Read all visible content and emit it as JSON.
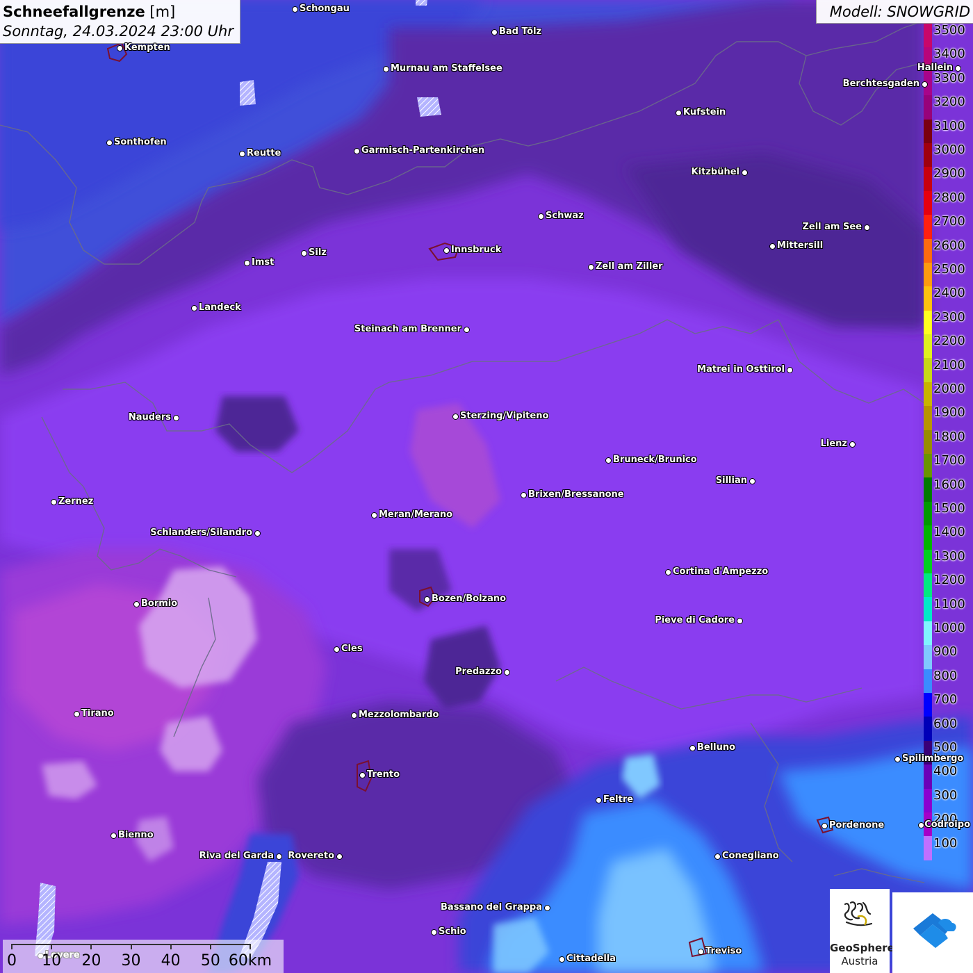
{
  "header": {
    "title_bold": "Schneefallgrenze",
    "title_unit": "[m]",
    "datetime": "Sonntag, 24.03.2024 23:00 Uhr",
    "model": "Modell: SNOWGRID"
  },
  "legend": {
    "unit": "m",
    "entries": [
      {
        "label": "3500",
        "color": "#c8076a"
      },
      {
        "label": "3400",
        "color": "#b8057a"
      },
      {
        "label": "3300",
        "color": "#a8048a"
      },
      {
        "label": "3200",
        "color": "#98027a"
      },
      {
        "label": "3100",
        "color": "#7a0010"
      },
      {
        "label": "3000",
        "color": "#a00010"
      },
      {
        "label": "2900",
        "color": "#c80010"
      },
      {
        "label": "2800",
        "color": "#e60010"
      },
      {
        "label": "2700",
        "color": "#ff2010"
      },
      {
        "label": "2600",
        "color": "#ff6a10"
      },
      {
        "label": "2500",
        "color": "#ff9a10"
      },
      {
        "label": "2400",
        "color": "#ffc010"
      },
      {
        "label": "2300",
        "color": "#ffff20"
      },
      {
        "label": "2200",
        "color": "#e0f020"
      },
      {
        "label": "2100",
        "color": "#c8d818"
      },
      {
        "label": "2000",
        "color": "#c8b400"
      },
      {
        "label": "1900",
        "color": "#b89400"
      },
      {
        "label": "1800",
        "color": "#988c00"
      },
      {
        "label": "1700",
        "color": "#6a9400"
      },
      {
        "label": "1600",
        "color": "#007a00"
      },
      {
        "label": "1500",
        "color": "#009a00"
      },
      {
        "label": "1400",
        "color": "#00b400"
      },
      {
        "label": "1300",
        "color": "#00d020"
      },
      {
        "label": "1200",
        "color": "#00e880"
      },
      {
        "label": "1100",
        "color": "#00e8c8"
      },
      {
        "label": "1000",
        "color": "#80f4ff"
      },
      {
        "label": "900",
        "color": "#80c8ff"
      },
      {
        "label": "800",
        "color": "#3a8cff"
      },
      {
        "label": "700",
        "color": "#0000ff"
      },
      {
        "label": "600",
        "color": "#0000b8"
      },
      {
        "label": "500",
        "color": "#3a0078"
      },
      {
        "label": "400",
        "color": "#6a00b8"
      },
      {
        "label": "300",
        "color": "#8a00d0"
      },
      {
        "label": "200",
        "color": "#a400c8"
      },
      {
        "label": "100",
        "color": "#c070ff"
      }
    ]
  },
  "cities": [
    {
      "name": "Schongau",
      "side": "right"
    },
    {
      "name": "Kempten",
      "side": "right"
    },
    {
      "name": "Bad Tölz",
      "side": "right"
    },
    {
      "name": "Murnau am Staffelsee",
      "side": "right"
    },
    {
      "name": "Berchtesgaden",
      "side": "left"
    },
    {
      "name": "Kufstein",
      "side": "right"
    },
    {
      "name": "Sonthofen",
      "side": "right"
    },
    {
      "name": "Reutte",
      "side": "right"
    },
    {
      "name": "Garmisch-Partenkirchen",
      "side": "right"
    },
    {
      "name": "Kitzbühel",
      "side": "left"
    },
    {
      "name": "Schwaz",
      "side": "right"
    },
    {
      "name": "Zell am See",
      "side": "left"
    },
    {
      "name": "Mittersill",
      "side": "right"
    },
    {
      "name": "Innsbruck",
      "side": "right"
    },
    {
      "name": "Imst",
      "side": "right"
    },
    {
      "name": "Silz",
      "side": "right"
    },
    {
      "name": "Zell am Ziller",
      "side": "right"
    },
    {
      "name": "Landeck",
      "side": "right"
    },
    {
      "name": "Steinach am Brenner",
      "side": "left"
    },
    {
      "name": "Matrei in Osttirol",
      "side": "left"
    },
    {
      "name": "Nauders",
      "side": "left"
    },
    {
      "name": "Sterzing/Vipiteno",
      "side": "right"
    },
    {
      "name": "Lienz",
      "side": "left"
    },
    {
      "name": "Bruneck/Brunico",
      "side": "right"
    },
    {
      "name": "Sillian",
      "side": "left"
    },
    {
      "name": "Zernez",
      "side": "right"
    },
    {
      "name": "Brixen/Bressanone",
      "side": "right"
    },
    {
      "name": "Meran/Merano",
      "side": "right"
    },
    {
      "name": "Schlanders/Silandro",
      "side": "left"
    },
    {
      "name": "Cortina d'Ampezzo",
      "side": "right"
    },
    {
      "name": "Bormio",
      "side": "right"
    },
    {
      "name": "Bozen/Bolzano",
      "side": "right"
    },
    {
      "name": "Pieve di Cadore",
      "side": "left"
    },
    {
      "name": "Cles",
      "side": "right"
    },
    {
      "name": "Predazzo",
      "side": "left"
    },
    {
      "name": "Tirano",
      "side": "right"
    },
    {
      "name": "Mezzolombardo",
      "side": "right"
    },
    {
      "name": "Belluno",
      "side": "right"
    },
    {
      "name": "Spilimbergo",
      "side": "right"
    },
    {
      "name": "Trento",
      "side": "right"
    },
    {
      "name": "Feltre",
      "side": "right"
    },
    {
      "name": "Pordenone",
      "side": "right"
    },
    {
      "name": "Bienno",
      "side": "right"
    },
    {
      "name": "Riva del Garda",
      "side": "left"
    },
    {
      "name": "Rovereto",
      "side": "left"
    },
    {
      "name": "Conegliano",
      "side": "right"
    },
    {
      "name": "Bassano del Grappa",
      "side": "left"
    },
    {
      "name": "Schio",
      "side": "right"
    },
    {
      "name": "Treviso",
      "side": "right"
    },
    {
      "name": "Cittadella",
      "side": "right"
    },
    {
      "name": "Lovere",
      "side": "right"
    },
    {
      "name": "Hallein",
      "side": "left"
    },
    {
      "name": "Codroipo",
      "side": "right"
    }
  ],
  "scalebar": {
    "labels": [
      "0",
      "10",
      "20",
      "30",
      "40",
      "50",
      "60km"
    ]
  },
  "logos": {
    "geosphere_line1": "GeoSphere",
    "geosphere_line2": "Austria"
  }
}
